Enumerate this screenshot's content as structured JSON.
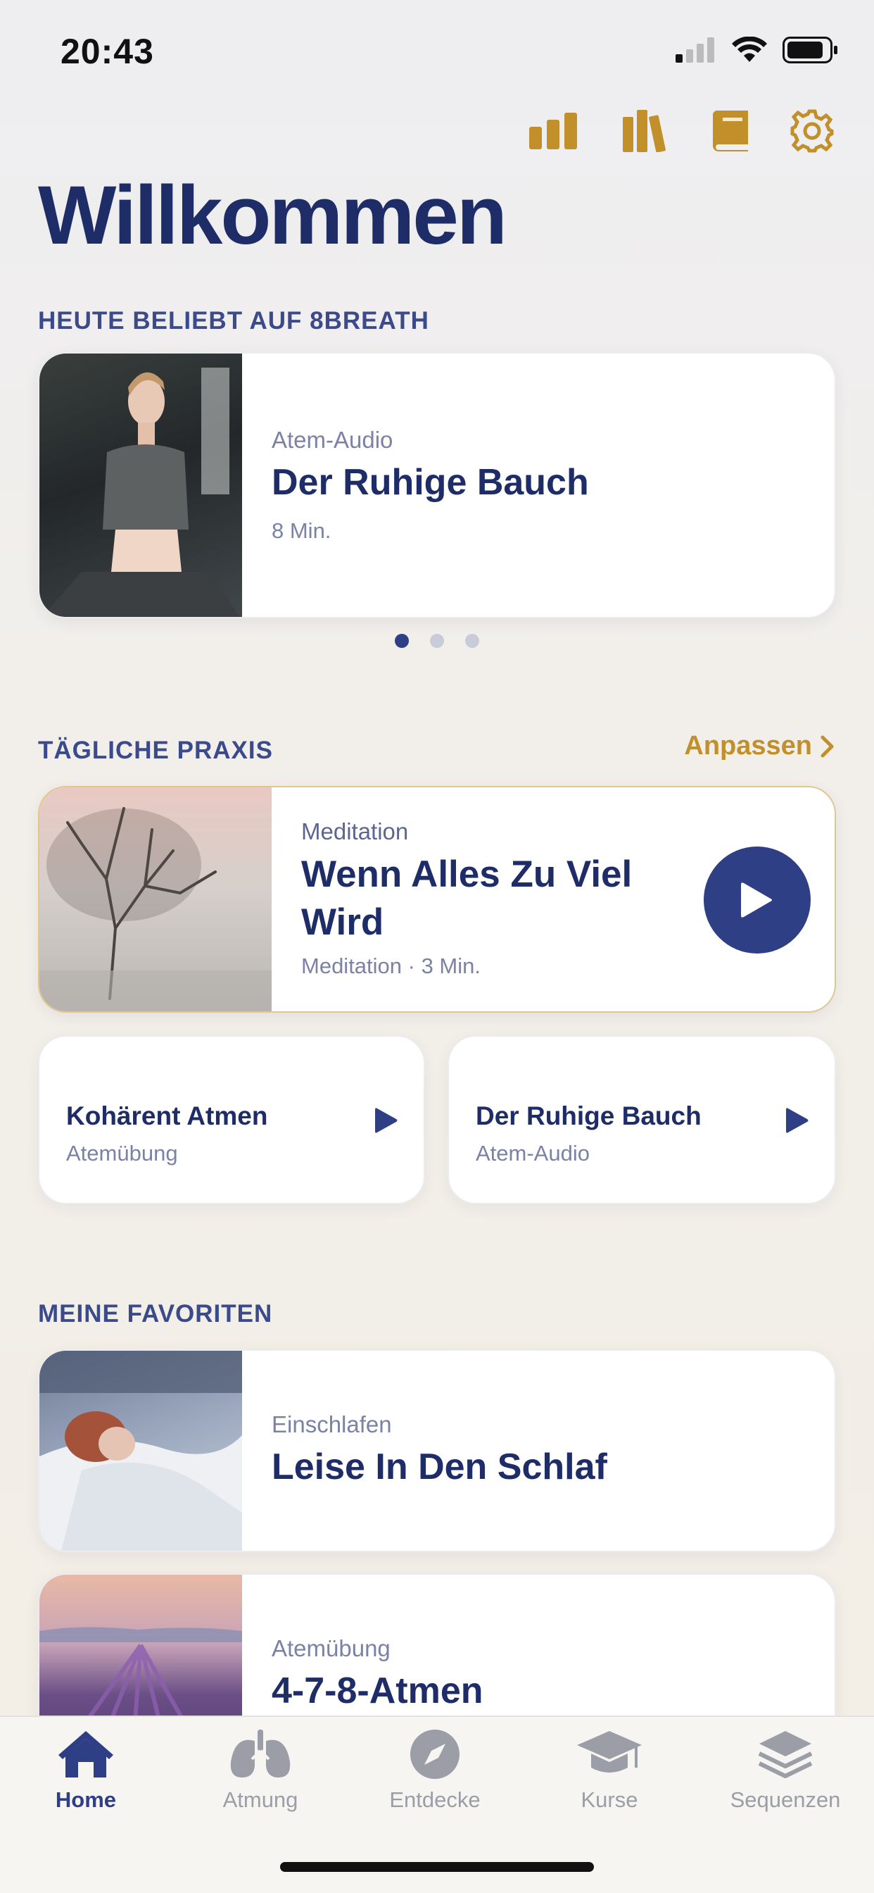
{
  "status": {
    "time": "20:43"
  },
  "header": {
    "title": "Willkommen",
    "icons": [
      "stats-icon",
      "library-icon",
      "book-icon",
      "settings-icon"
    ],
    "accent_color": "#c1902a"
  },
  "popular": {
    "label": "HEUTE BELIEBT AUF 8BREATH",
    "card": {
      "kicker": "Atem-Audio",
      "title": "Der Ruhige Bauch",
      "meta": "8 Min."
    },
    "page_count": 3,
    "active_page": 1
  },
  "daily": {
    "label": "TÄGLICHE PRAXIS",
    "adjust_label": "Anpassen",
    "featured": {
      "kicker": "Meditation",
      "title_line1": "Wenn Alles Zu Viel",
      "title_line2": "Wird",
      "meta": "Meditation · 3 Min."
    },
    "mini": [
      {
        "title": "Kohärent Atmen",
        "subtitle": "Atemübung"
      },
      {
        "title": "Der Ruhige Bauch",
        "subtitle": "Atem-Audio"
      }
    ]
  },
  "favorites": {
    "label": "MEINE FAVORITEN",
    "items": [
      {
        "kicker": "Einschlafen",
        "title": "Leise In Den Schlaf"
      },
      {
        "kicker": "Atemübung",
        "title": "4-7-8-Atmen"
      }
    ]
  },
  "tabs": [
    {
      "label": "Home",
      "icon": "home-icon",
      "active": true
    },
    {
      "label": "Atmung",
      "icon": "lungs-icon",
      "active": false
    },
    {
      "label": "Entdecke",
      "icon": "compass-icon",
      "active": false
    },
    {
      "label": "Kurse",
      "icon": "graduation-cap-icon",
      "active": false
    },
    {
      "label": "Sequenzen",
      "icon": "layers-icon",
      "active": false
    }
  ],
  "colors": {
    "navy": "#1e2c68",
    "primary": "#2f3f86",
    "accent": "#c1902a"
  }
}
